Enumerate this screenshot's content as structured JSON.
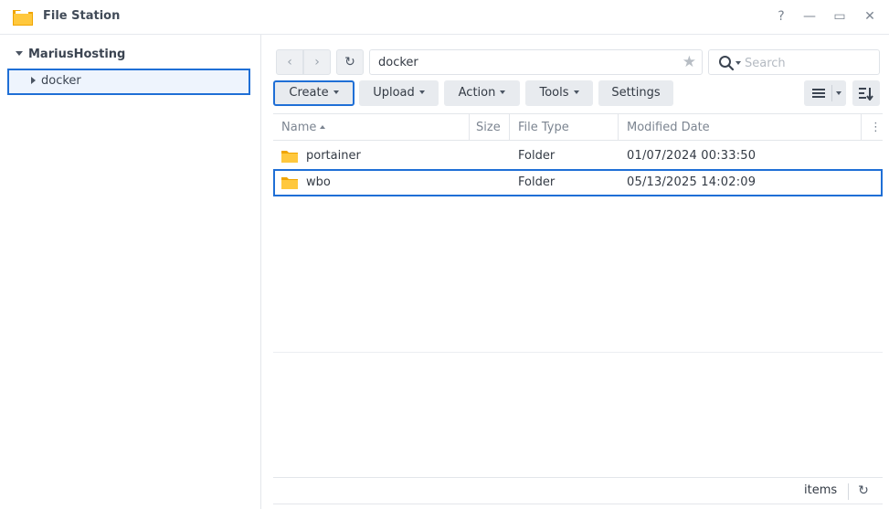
{
  "window": {
    "title": "File Station",
    "controls": {
      "help": "?",
      "minimize": "—",
      "maximize": "▭",
      "close": "✕"
    }
  },
  "tree": {
    "root_label": "MariusHosting",
    "children": [
      {
        "label": "docker",
        "selected": true
      }
    ]
  },
  "nav": {
    "back": "‹",
    "forward": "›",
    "refresh": "↻",
    "path": "docker",
    "favorite_icon": "★",
    "search_placeholder": "Search"
  },
  "toolbar": {
    "create": "Create",
    "upload": "Upload",
    "action": "Action",
    "tools": "Tools",
    "settings": "Settings"
  },
  "grid": {
    "columns": {
      "name": "Name",
      "size": "Size",
      "type": "File Type",
      "modified": "Modified Date",
      "more": "⋮"
    },
    "sort_column": "name",
    "sort_direction": "ascending",
    "rows": [
      {
        "name": "portainer",
        "size": "",
        "type": "Folder",
        "modified": "01/07/2024 00:33:50",
        "selected": false
      },
      {
        "name": "wbo",
        "size": "",
        "type": "Folder",
        "modified": "05/13/2025 14:02:09",
        "selected": true
      }
    ]
  },
  "footer": {
    "items_label": "items",
    "refresh": "↻"
  },
  "colors": {
    "selection": "#1f6fd6",
    "folder": "#f5b921",
    "button_bg": "#e8ebef"
  }
}
